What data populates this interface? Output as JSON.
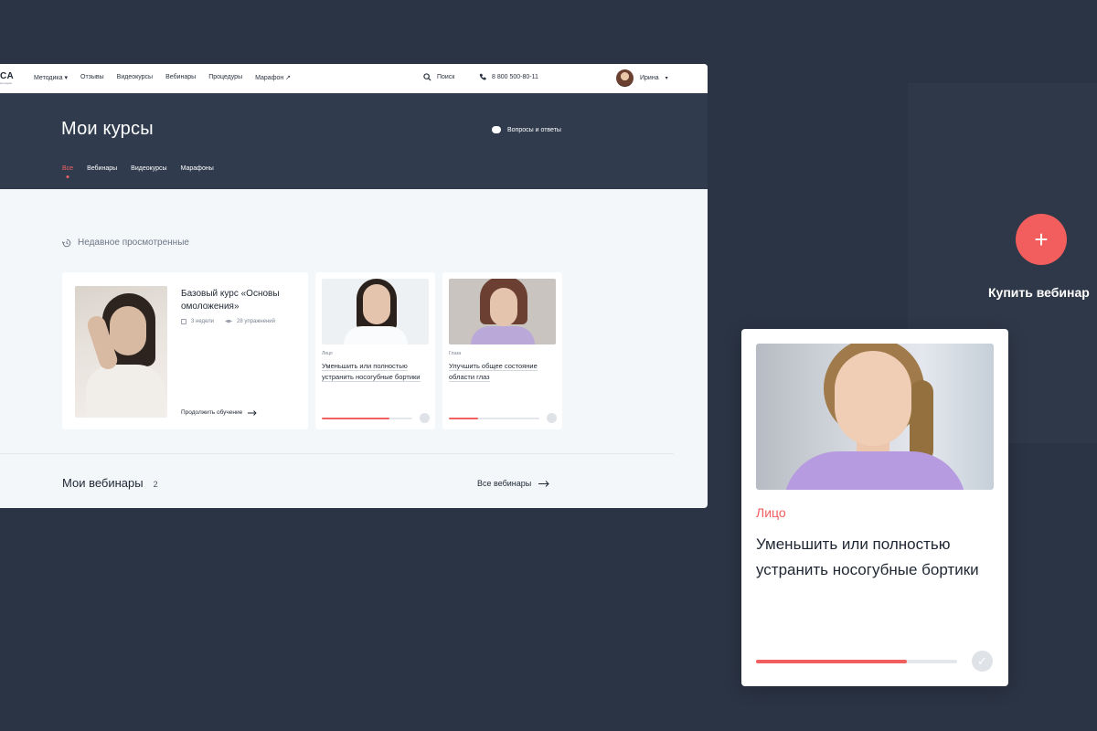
{
  "nav": {
    "logo": "CA",
    "logo_sub": "методики",
    "menu": [
      {
        "label": "Методика ▾"
      },
      {
        "label": "Отзывы"
      },
      {
        "label": "Видеокурсы"
      },
      {
        "label": "Вебинары"
      },
      {
        "label": "Процедуры"
      },
      {
        "label": "Марафон ↗"
      }
    ],
    "search_label": "Поиск",
    "phone": "8 800 500-80-11",
    "user_name": "Ирина"
  },
  "hero": {
    "title": "Мои курсы",
    "qa_label": "Вопросы и ответы",
    "tabs": [
      {
        "label": "Все",
        "active": true
      },
      {
        "label": "Вебинары"
      },
      {
        "label": "Видеокурсы"
      },
      {
        "label": "Марафоны"
      }
    ]
  },
  "recent": {
    "label": "Недавное просмотренные",
    "main_card": {
      "title": "Базовый курс «Основы омоложения»",
      "duration": "3 недели",
      "exercises": "28 упражнений",
      "continue_label": "Продолжить обучение"
    },
    "cards": [
      {
        "category": "Лицо",
        "title": "Уменьшить или полностью устранить носогубные бортики",
        "progress": 0.75
      },
      {
        "category": "Глаза",
        "title": "Улучшить общее состояние области глаз",
        "progress": 0.32
      }
    ]
  },
  "webinars": {
    "title": "Мои вебинары",
    "count": "2",
    "all_label": "Все вебинары"
  },
  "buy": {
    "plus": "+",
    "label": "Купить вебинар"
  },
  "zoom_card": {
    "category": "Лицо",
    "title": "Уменьшить или полностью устранить носогубные бортики",
    "progress": 0.75
  },
  "colors": {
    "accent": "#f25e5e",
    "dark_bg": "#2b3444",
    "hero_bg": "#303c4e"
  }
}
